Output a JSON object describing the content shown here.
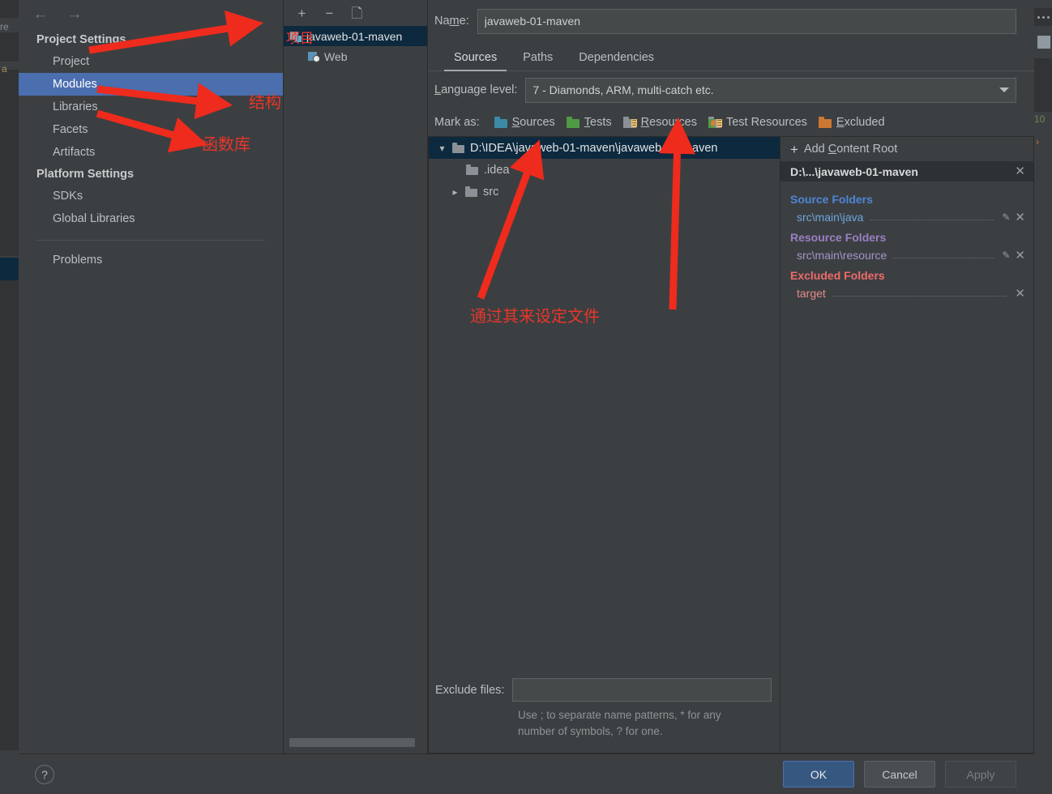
{
  "background": {
    "left_fragment_1": "re",
    "left_fragment_2": "a"
  },
  "nav": {
    "back_icon": "arrow-left-icon",
    "forward_icon": "arrow-right-icon",
    "groups": [
      {
        "title": "Project Settings",
        "items": [
          "Project",
          "Modules",
          "Libraries",
          "Facets",
          "Artifacts"
        ]
      },
      {
        "title": "Platform Settings",
        "items": [
          "SDKs",
          "Global Libraries"
        ]
      }
    ],
    "selected": "Modules",
    "problems": "Problems"
  },
  "middle": {
    "toolbar": {
      "add": "+",
      "remove": "−",
      "copy": "copy-icon"
    },
    "tree": [
      {
        "label": "javaweb-01-maven",
        "icon": "module-icon",
        "selected": true
      },
      {
        "label": "Web",
        "icon": "web-facet-icon",
        "selected": false
      }
    ]
  },
  "content": {
    "name_label": "Name:",
    "name_value": "javaweb-01-maven",
    "tabs": [
      {
        "label": "Sources",
        "active": true
      },
      {
        "label": "Paths",
        "active": false
      },
      {
        "label": "Dependencies",
        "active": false
      }
    ],
    "language_level_label": "Language level:",
    "language_level_value": "7 - Diamonds, ARM, multi-catch etc.",
    "mark_as_label": "Mark as:",
    "mark_as": [
      {
        "label": "Sources",
        "color": "#3b8ba8",
        "kind": "plain"
      },
      {
        "label": "Tests",
        "color": "#4f9a45",
        "kind": "plain"
      },
      {
        "label": "Resources",
        "color": "#8b9196",
        "kind": "lines"
      },
      {
        "label": "Test Resources",
        "color": "#8b9196",
        "kind": "test-lines"
      },
      {
        "label": "Excluded",
        "color": "#cc7832",
        "kind": "plain"
      }
    ],
    "content_tree": [
      {
        "label": "D:\\IDEA\\javaweb-01-maven\\javaweb-01-maven",
        "level": 0,
        "expanded": true,
        "selected": true
      },
      {
        "label": ".idea",
        "level": 1,
        "expanded": false,
        "selected": false
      },
      {
        "label": "src",
        "level": 1,
        "expanded": false,
        "selected": false,
        "has_chevron": true
      }
    ],
    "exclude_files_label": "Exclude files:",
    "exclude_files_value": "",
    "exclude_hint_1": "Use ; to separate name patterns, * for any",
    "exclude_hint_2": "number of symbols, ? for one."
  },
  "roots": {
    "add_content_root": "Add Content Root",
    "root_header": "D:\\...\\javaweb-01-maven",
    "groups": [
      {
        "title": "Source Folders",
        "kind": "src",
        "rows": [
          {
            "path": "src\\main\\java",
            "has_pencil": true
          }
        ]
      },
      {
        "title": "Resource Folders",
        "kind": "res",
        "rows": [
          {
            "path": "src\\main\\resource",
            "has_pencil": true
          }
        ]
      },
      {
        "title": "Excluded Folders",
        "kind": "exc",
        "rows": [
          {
            "path": "target",
            "has_pencil": false
          }
        ]
      }
    ]
  },
  "footer": {
    "help": "?",
    "ok": "OK",
    "cancel": "Cancel",
    "apply": "Apply"
  },
  "annotations": {
    "project": "项目",
    "structure": "结构",
    "library": "函数库",
    "set_file": "通过其来设定文件"
  },
  "colors": {
    "accent": "#4b6eaf",
    "selection_tree": "#0d293e",
    "annotation_red": "#e8362a",
    "source_blue": "#4d86d6",
    "resource_purple": "#9a7fc4",
    "excluded_red": "#f06a6a"
  }
}
